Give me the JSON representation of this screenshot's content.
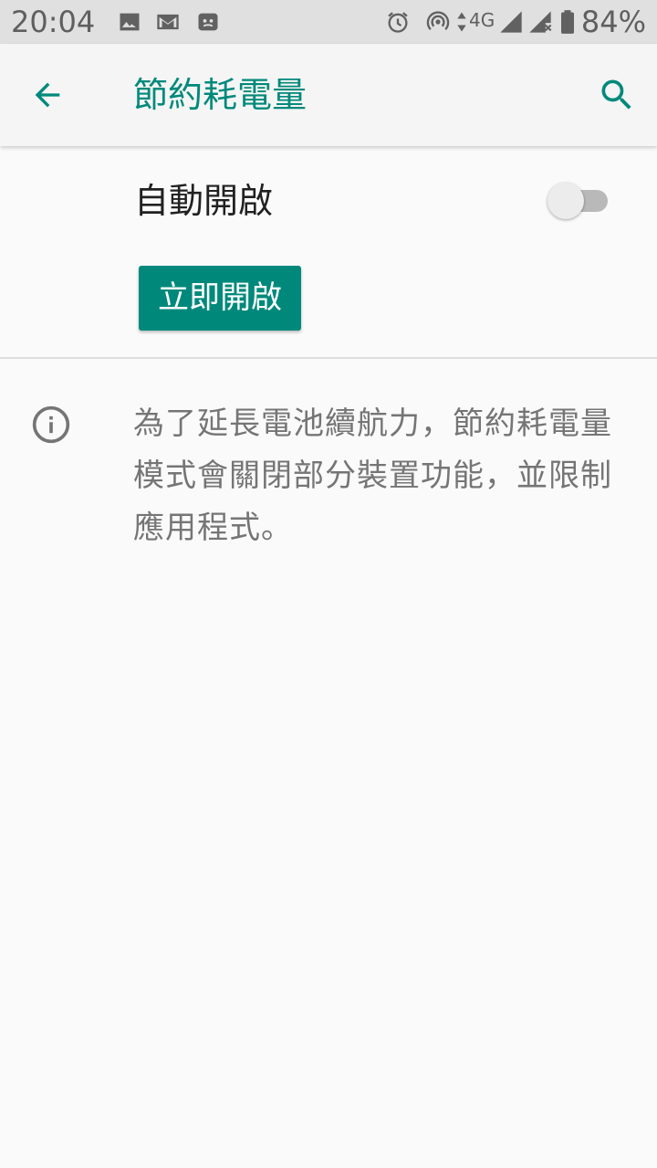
{
  "status_bar": {
    "time": "20:04",
    "network": "4G",
    "battery": "84%",
    "icons": [
      "image-icon",
      "gmail-icon",
      "notification-icon",
      "alarm-icon",
      "hotspot-icon",
      "data-arrows-icon",
      "signal-icon",
      "signal-no-sim-icon",
      "battery-icon"
    ]
  },
  "app_bar": {
    "title": "節約耗電量",
    "accent_color": "#00897b"
  },
  "settings": {
    "auto_label": "自動開啟",
    "auto_enabled": false,
    "turn_on_button": "立即開啟",
    "info_text": "為了延長電池續航力，節約耗電量模式會關閉部分裝置功能，並限制應用程式。"
  }
}
